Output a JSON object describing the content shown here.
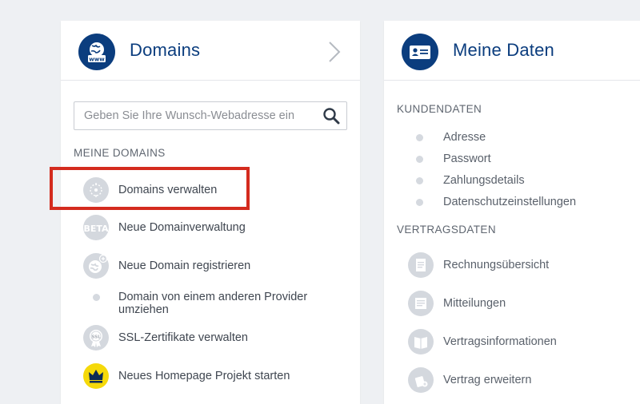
{
  "domains_card": {
    "title": "Domains",
    "search": {
      "placeholder": "Geben Sie Ihre Wunsch-Webadresse ein",
      "value": ""
    },
    "section_label": "MEINE DOMAINS",
    "items": [
      {
        "label": "Domains verwalten",
        "icon": "globe-pin-icon"
      },
      {
        "label": "Neue Domainverwaltung",
        "icon": "beta-badge-icon",
        "badge": "BETA"
      },
      {
        "label": "Neue Domain registrieren",
        "icon": "globe-plus-icon"
      },
      {
        "label_line1": "Domain von einem anderen Provider",
        "label_line2": "umziehen",
        "icon": "bullet-dot"
      },
      {
        "label": "SSL-Zertifikate verwalten",
        "icon": "ssl-seal-icon",
        "badge": "SSL"
      },
      {
        "label": "Neues Homepage Projekt starten",
        "icon": "crown-icon"
      }
    ]
  },
  "my_data_card": {
    "title": "Meine Daten",
    "customer_section_label": "KUNDENDATEN",
    "customer_items": [
      "Adresse",
      "Passwort",
      "Zahlungsdetails",
      "Datenschutzeinstellungen"
    ],
    "contract_section_label": "VERTRAGSDATEN",
    "contract_items": [
      {
        "label": "Rechnungsübersicht",
        "icon": "invoice-icon"
      },
      {
        "label": "Mitteilungen",
        "icon": "message-icon"
      },
      {
        "label": "Vertragsinformationen",
        "icon": "contract-book-icon"
      },
      {
        "label": "Vertrag erweitern",
        "icon": "extend-contract-icon"
      }
    ]
  },
  "colors": {
    "brand_blue": "#0b3d7e",
    "highlight_red": "#d42b1e",
    "crown_yellow": "#f5d90a",
    "icon_gray": "#d4d8de"
  }
}
